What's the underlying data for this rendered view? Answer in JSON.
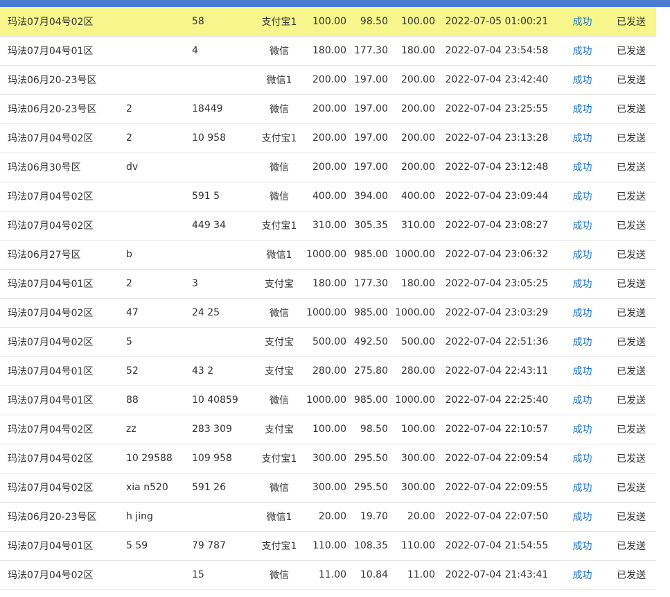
{
  "rows": [
    {
      "area": "玛法07月04号02区",
      "user": "",
      "acct": "58",
      "pay": "支付宝1",
      "amount": "100.00",
      "actual": "98.50",
      "credit": "100.00",
      "time": "2022-07-05 01:00:21",
      "status": "成功",
      "notify": "已发送",
      "highlight": true
    },
    {
      "area": "玛法07月04号01区",
      "user": "",
      "acct": "4",
      "pay": "微信",
      "amount": "180.00",
      "actual": "177.30",
      "credit": "180.00",
      "time": "2022-07-04 23:54:58",
      "status": "成功",
      "notify": "已发送"
    },
    {
      "area": "玛法06月20-23号区",
      "user": "",
      "acct": "",
      "pay": "微信1",
      "amount": "200.00",
      "actual": "197.00",
      "credit": "200.00",
      "time": "2022-07-04 23:42:40",
      "status": "成功",
      "notify": "已发送"
    },
    {
      "area": "玛法06月20-23号区",
      "user": "2",
      "acct": "18449",
      "pay": "微信",
      "amount": "200.00",
      "actual": "197.00",
      "credit": "200.00",
      "time": "2022-07-04 23:25:55",
      "status": "成功",
      "notify": "已发送"
    },
    {
      "area": "玛法07月04号02区",
      "user": "2",
      "acct": "10 958",
      "pay": "支付宝1",
      "amount": "200.00",
      "actual": "197.00",
      "credit": "200.00",
      "time": "2022-07-04 23:13:28",
      "status": "成功",
      "notify": "已发送"
    },
    {
      "area": "玛法06月30号区",
      "user": "dv",
      "acct": "",
      "pay": "微信",
      "amount": "200.00",
      "actual": "197.00",
      "credit": "200.00",
      "time": "2022-07-04 23:12:48",
      "status": "成功",
      "notify": "已发送"
    },
    {
      "area": "玛法07月04号02区",
      "user": "",
      "acct": "591 5",
      "pay": "微信",
      "amount": "400.00",
      "actual": "394.00",
      "credit": "400.00",
      "time": "2022-07-04 23:09:44",
      "status": "成功",
      "notify": "已发送"
    },
    {
      "area": "玛法07月04号02区",
      "user": "",
      "acct": "449 34",
      "pay": "支付宝1",
      "amount": "310.00",
      "actual": "305.35",
      "credit": "310.00",
      "time": "2022-07-04 23:08:27",
      "status": "成功",
      "notify": "已发送"
    },
    {
      "area": "玛法06月27号区",
      "user": "b",
      "acct": "",
      "pay": "微信1",
      "amount": "1000.00",
      "actual": "985.00",
      "credit": "1000.00",
      "time": "2022-07-04 23:06:32",
      "status": "成功",
      "notify": "已发送"
    },
    {
      "area": "玛法07月04号01区",
      "user": "2",
      "acct": "3",
      "pay": "支付宝",
      "amount": "180.00",
      "actual": "177.30",
      "credit": "180.00",
      "time": "2022-07-04 23:05:25",
      "status": "成功",
      "notify": "已发送"
    },
    {
      "area": "玛法07月04号02区",
      "user": "47",
      "acct": "24 25",
      "pay": "微信",
      "amount": "1000.00",
      "actual": "985.00",
      "credit": "1000.00",
      "time": "2022-07-04 23:03:29",
      "status": "成功",
      "notify": "已发送"
    },
    {
      "area": "玛法07月04号02区",
      "user": "5",
      "acct": "",
      "pay": "支付宝",
      "amount": "500.00",
      "actual": "492.50",
      "credit": "500.00",
      "time": "2022-07-04 22:51:36",
      "status": "成功",
      "notify": "已发送"
    },
    {
      "area": "玛法07月04号01区",
      "user": "52",
      "acct": "43 2",
      "pay": "支付宝",
      "amount": "280.00",
      "actual": "275.80",
      "credit": "280.00",
      "time": "2022-07-04 22:43:11",
      "status": "成功",
      "notify": "已发送"
    },
    {
      "area": "玛法07月04号01区",
      "user": "88",
      "acct": "10 40859",
      "pay": "微信",
      "amount": "1000.00",
      "actual": "985.00",
      "credit": "1000.00",
      "time": "2022-07-04 22:25:40",
      "status": "成功",
      "notify": "已发送"
    },
    {
      "area": "玛法07月04号02区",
      "user": "zz",
      "acct": "283 309",
      "pay": "支付宝",
      "amount": "100.00",
      "actual": "98.50",
      "credit": "100.00",
      "time": "2022-07-04 22:10:57",
      "status": "成功",
      "notify": "已发送"
    },
    {
      "area": "玛法07月04号02区",
      "user": "10 29588",
      "acct": "109 958",
      "pay": "支付宝1",
      "amount": "300.00",
      "actual": "295.50",
      "credit": "300.00",
      "time": "2022-07-04 22:09:54",
      "status": "成功",
      "notify": "已发送"
    },
    {
      "area": "玛法07月04号02区",
      "user": "xia n520",
      "acct": "591 26",
      "pay": "微信",
      "amount": "300.00",
      "actual": "295.50",
      "credit": "300.00",
      "time": "2022-07-04 22:09:55",
      "status": "成功",
      "notify": "已发送"
    },
    {
      "area": "玛法06月20-23号区",
      "user": "h jing",
      "acct": "",
      "pay": "微信1",
      "amount": "20.00",
      "actual": "19.70",
      "credit": "20.00",
      "time": "2022-07-04 22:07:50",
      "status": "成功",
      "notify": "已发送"
    },
    {
      "area": "玛法07月04号01区",
      "user": "5 59",
      "acct": "79 787",
      "pay": "支付宝1",
      "amount": "110.00",
      "actual": "108.35",
      "credit": "110.00",
      "time": "2022-07-04 21:54:55",
      "status": "成功",
      "notify": "已发送"
    },
    {
      "area": "玛法07月04号02区",
      "user": "",
      "acct": "15",
      "pay": "微信",
      "amount": "11.00",
      "actual": "10.84",
      "credit": "11.00",
      "time": "2022-07-04 21:43:41",
      "status": "成功",
      "notify": "已发送"
    }
  ],
  "colors": {
    "topbar": "#4b7ccf",
    "highlight": "#f6f68d",
    "status_link": "#1a73c9",
    "row_border": "#e6e6e6"
  }
}
